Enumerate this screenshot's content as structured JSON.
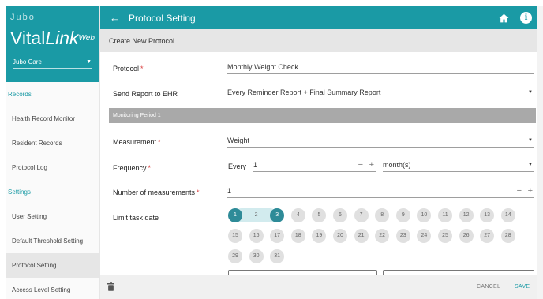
{
  "sidebar": {
    "brand_small": "Jubo",
    "brand_vital": "Vital",
    "brand_link": "Link",
    "brand_web": "Web",
    "org": "Jubo Care",
    "records_section": "Records",
    "records_items": [
      "Health Record Monitor",
      "Resident Records",
      "Protocol Log"
    ],
    "settings_section": "Settings",
    "settings_items": [
      "User Setting",
      "Default Threshold Setting",
      "Protocol Setting",
      "Access Level Setting"
    ],
    "active_item": "Protocol Setting"
  },
  "header": {
    "title": "Protocol Setting",
    "back_icon": "arrow-left-icon",
    "home_icon": "home-icon",
    "info_icon": "info-icon",
    "info_glyph": "i"
  },
  "subheader": {
    "title": "Create New Protocol"
  },
  "form": {
    "protocol_label": "Protocol",
    "protocol_value": "Monthly Weight Check",
    "send_report_label": "Send Report to EHR",
    "send_report_value": "Every Reminder Report + Final Summary Report",
    "period_title": "Monitoring Period 1",
    "measurement_label": "Measurement",
    "measurement_value": "Weight",
    "frequency_label": "Frequency",
    "frequency_prefix": "Every",
    "frequency_value": "1",
    "frequency_unit": "month(s)",
    "num_measurements_label": "Number of measurements",
    "num_measurements_value": "1",
    "limit_task_label": "Limit task date",
    "required_mark": "*",
    "minus": "−",
    "plus": "+"
  },
  "calendar": {
    "days": [
      "1",
      "2",
      "3",
      "4",
      "5",
      "6",
      "7",
      "8",
      "9",
      "10",
      "11",
      "12",
      "13",
      "14",
      "15",
      "16",
      "17",
      "18",
      "19",
      "20",
      "21",
      "22",
      "23",
      "24",
      "25",
      "26",
      "27",
      "28",
      "29",
      "30",
      "31"
    ],
    "selected": [
      "1",
      "3"
    ],
    "in_range": [
      "2"
    ]
  },
  "footer": {
    "cancel_label": "CANCEL",
    "save_label": "SAVE"
  },
  "colors": {
    "brand": "#1a9aa5",
    "selected_day": "#2e8b98",
    "range_day": "#d2ebee",
    "required": "#d93c3c"
  }
}
